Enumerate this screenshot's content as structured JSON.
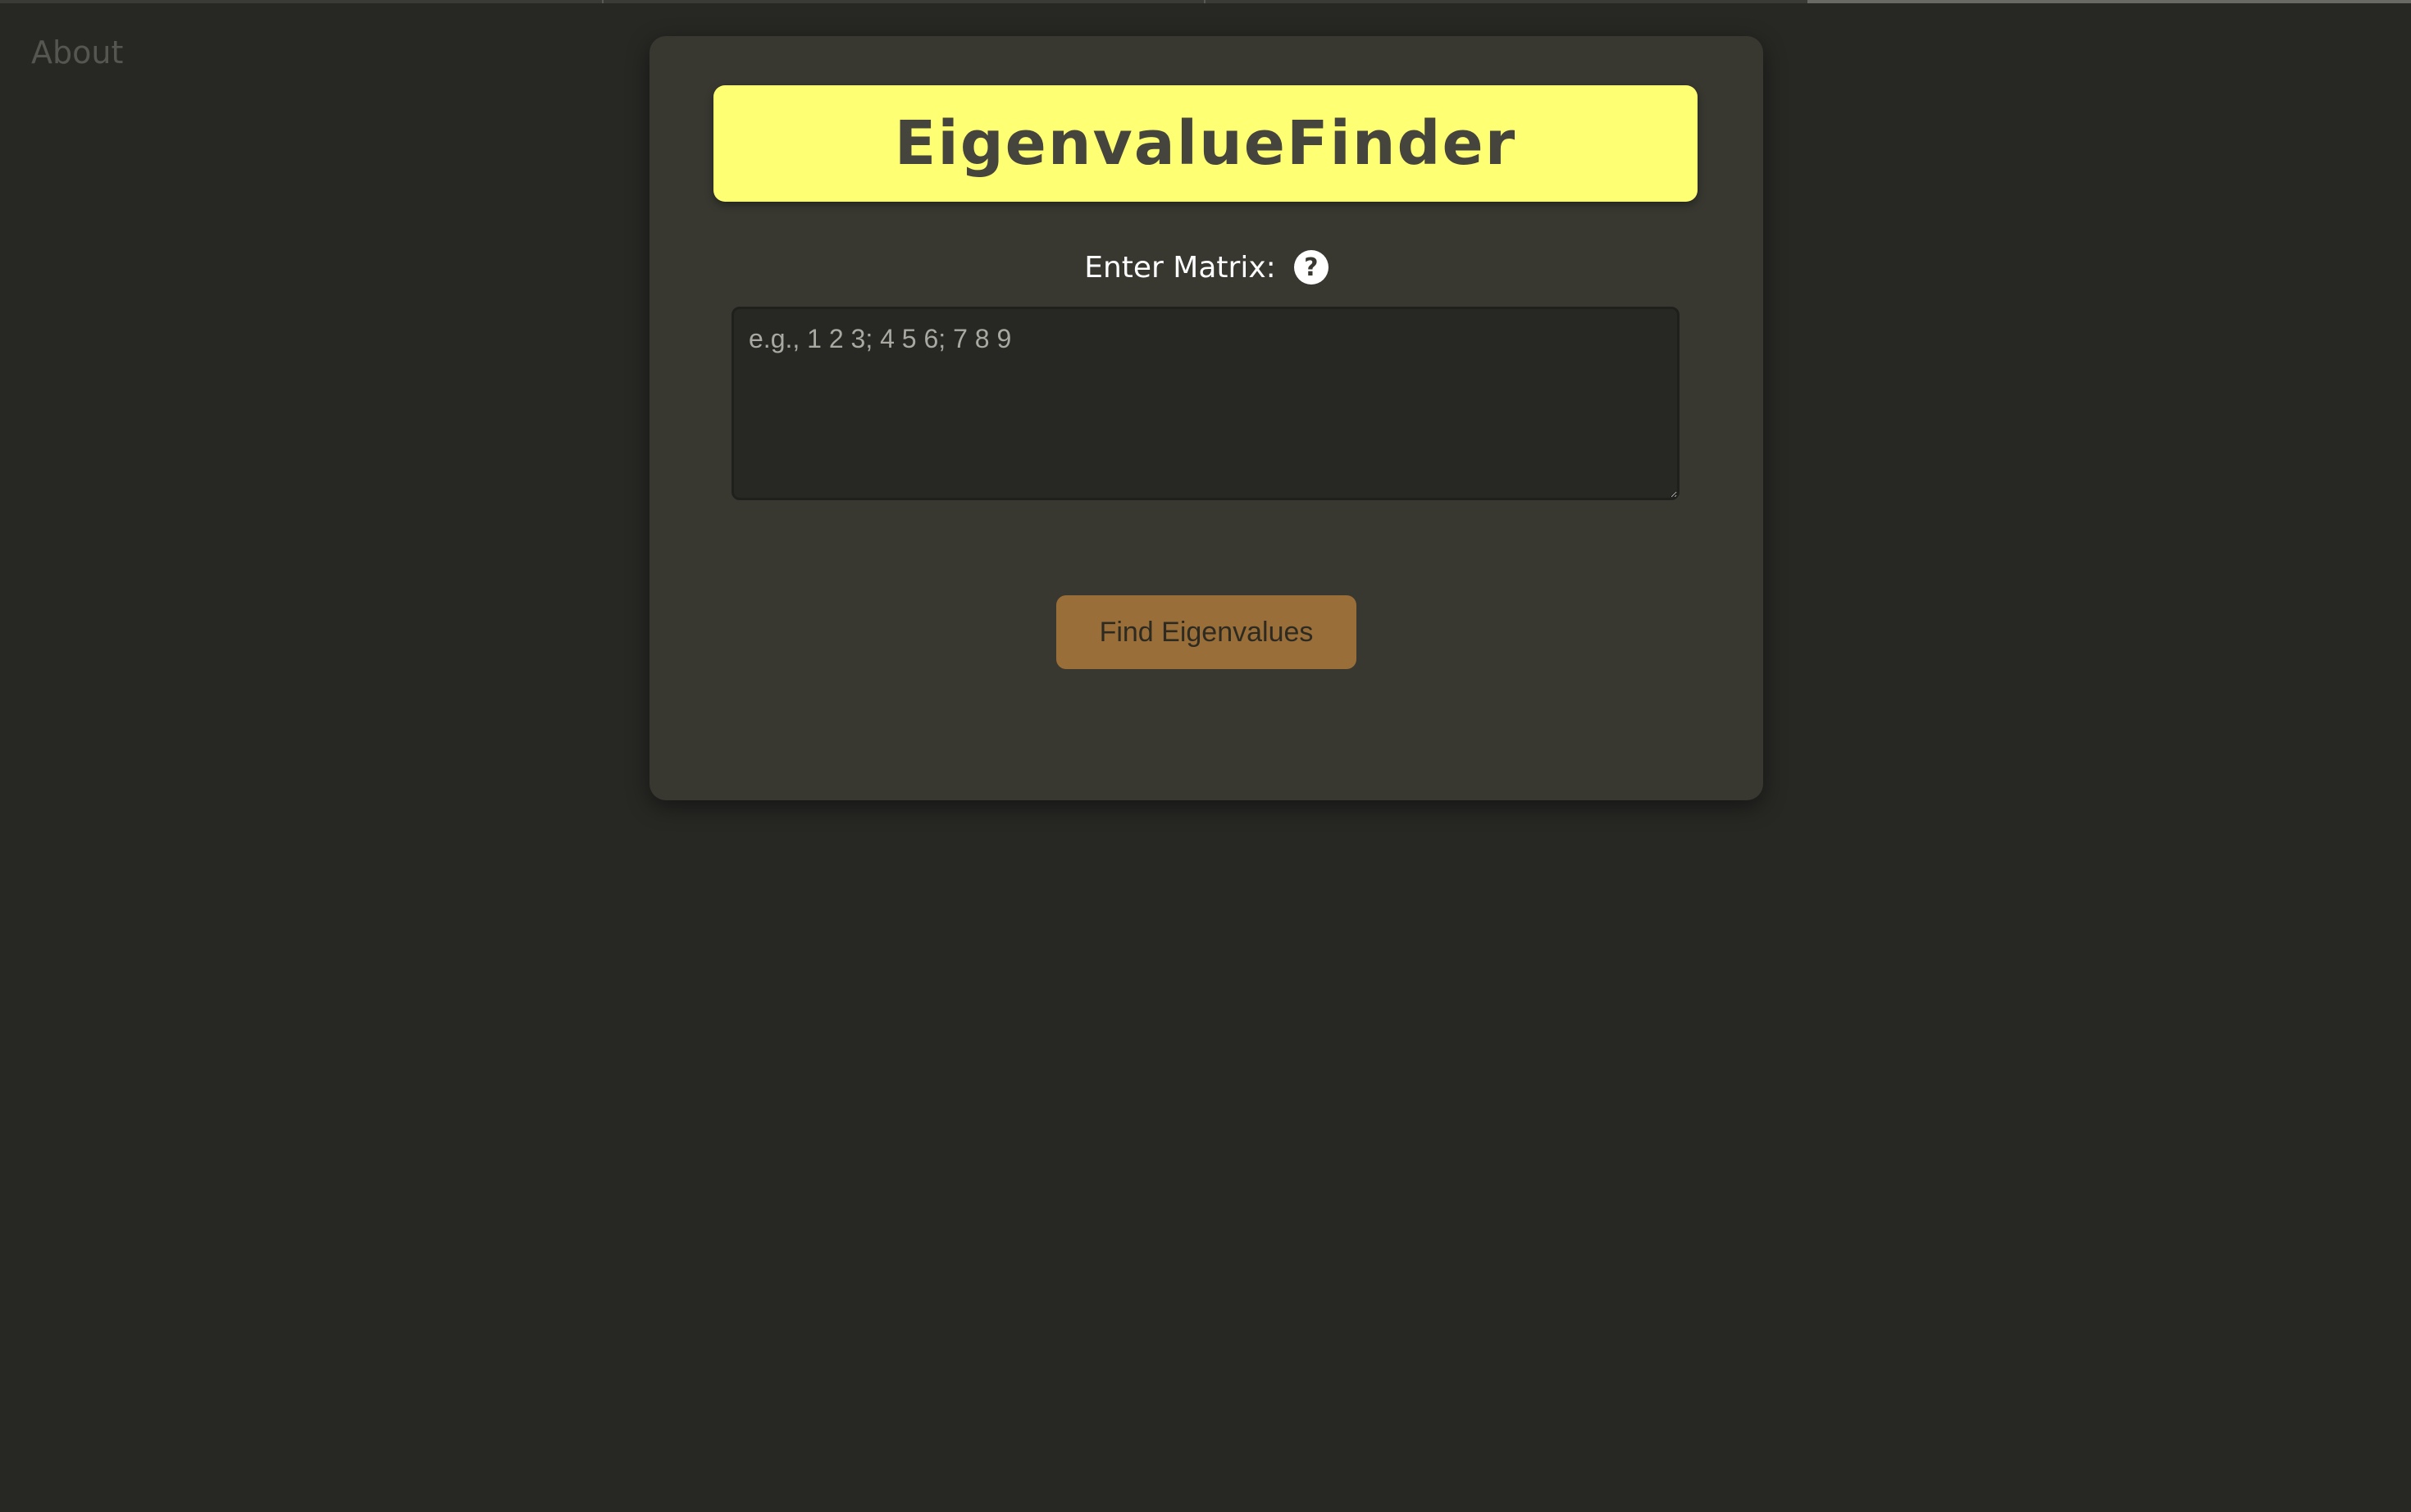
{
  "nav": {
    "about_label": "About"
  },
  "header": {
    "title": "EigenvalueFinder"
  },
  "form": {
    "matrix_label": "Enter Matrix:",
    "help_icon": "?",
    "matrix_value": "",
    "matrix_placeholder": "e.g., 1 2 3; 4 5 6; 7 8 9",
    "submit_label": "Find Eigenvalues"
  },
  "colors": {
    "background": "#272824",
    "card": "#383831",
    "title_banner": "#ffff74",
    "title_text": "#45443d",
    "button": "#9a6e38",
    "button_text": "#2d2a22"
  }
}
